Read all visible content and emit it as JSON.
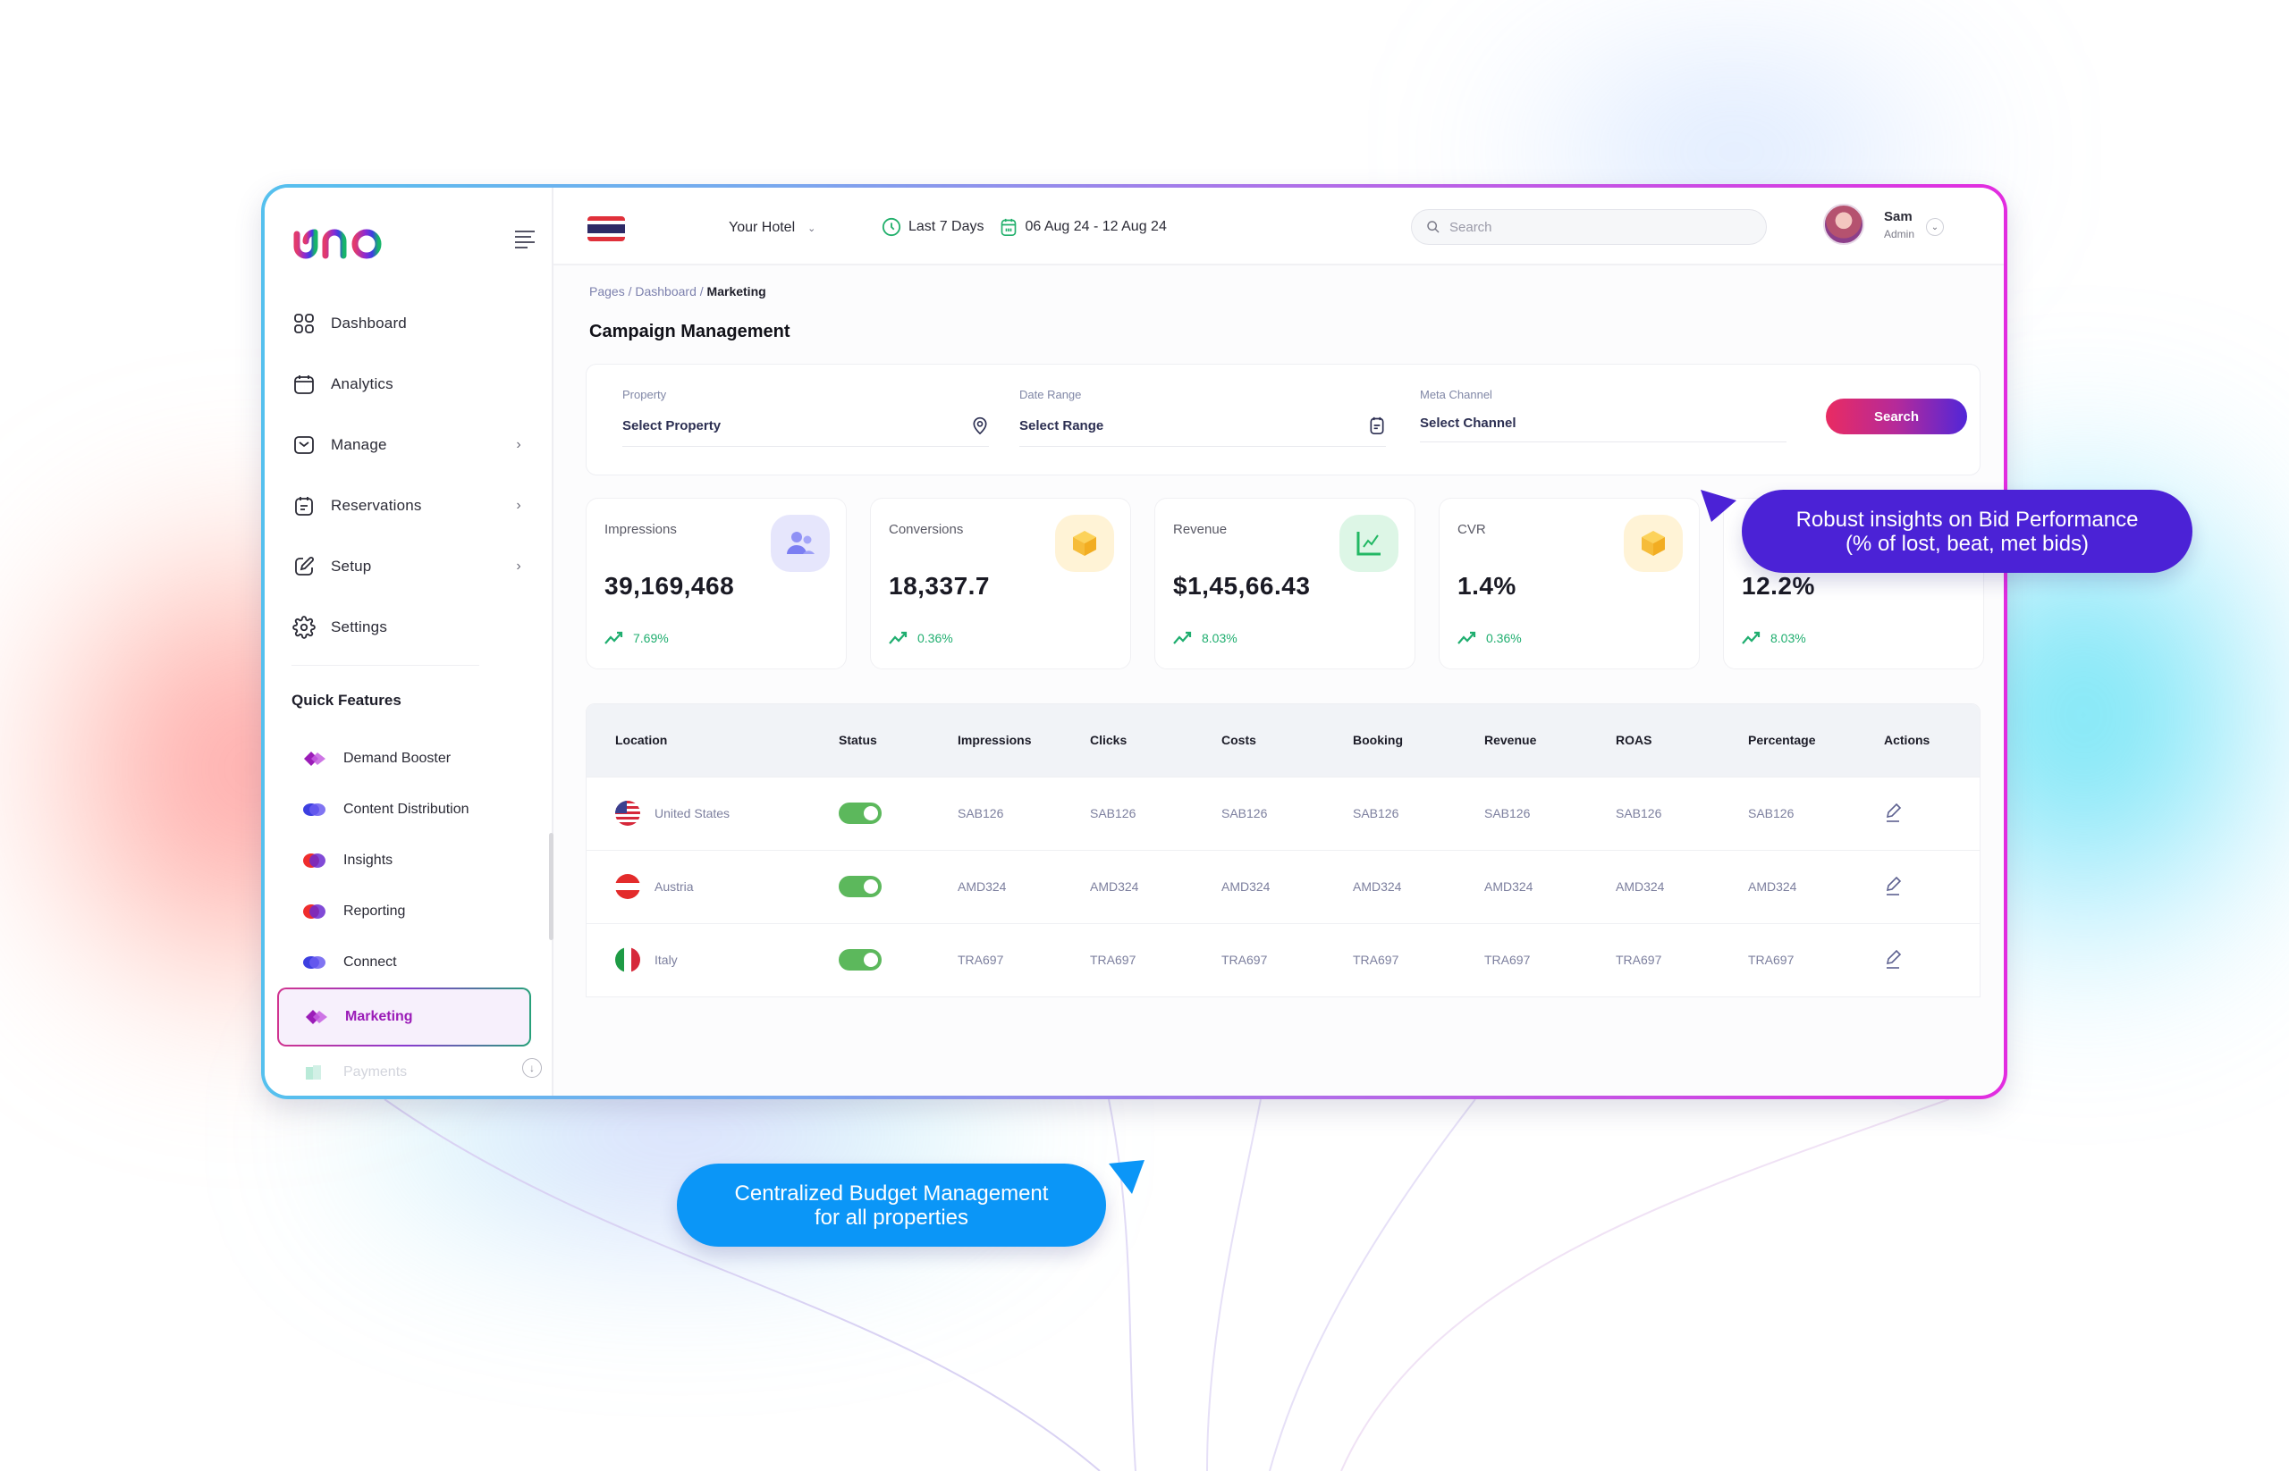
{
  "sidebar": {
    "logo_text": "uno",
    "nav": [
      {
        "label": "Dashboard",
        "icon": "grid-icon",
        "has_submenu": false
      },
      {
        "label": "Analytics",
        "icon": "calendar-icon",
        "has_submenu": false
      },
      {
        "label": "Manage",
        "icon": "inbox-icon",
        "has_submenu": true
      },
      {
        "label": "Reservations",
        "icon": "calendar-note-icon",
        "has_submenu": true
      },
      {
        "label": "Setup",
        "icon": "edit-icon",
        "has_submenu": true
      },
      {
        "label": "Settings",
        "icon": "gear-icon",
        "has_submenu": false
      }
    ],
    "quick_features_title": "Quick Features",
    "quick_features": [
      {
        "label": "Demand Booster",
        "icon": "demand-booster-icon"
      },
      {
        "label": "Content Distribution",
        "icon": "content-distribution-icon"
      },
      {
        "label": "Insights",
        "icon": "insights-icon"
      },
      {
        "label": "Reporting",
        "icon": "reporting-icon"
      },
      {
        "label": "Connect",
        "icon": "connect-icon"
      },
      {
        "label": "Marketing",
        "icon": "marketing-icon",
        "active": true
      },
      {
        "label": "Payments",
        "icon": "payments-icon"
      }
    ],
    "chevron": "›",
    "scroll_down": "↓"
  },
  "header": {
    "hotel_label": "Your Hotel",
    "hotel_chevron": "⌄",
    "range_preset": "Last 7 Days",
    "range_dates": "06 Aug 24 - 12 Aug 24",
    "search_placeholder": "Search",
    "user_name": "Sam",
    "user_role": "Admin",
    "user_chevron": "⌄"
  },
  "breadcrumb": {
    "items": [
      "Pages",
      "Dashboard"
    ],
    "separator": " / ",
    "current": "Marketing"
  },
  "page_title": "Campaign Management",
  "filters": {
    "property": {
      "label": "Property",
      "value": "Select Property"
    },
    "date_range": {
      "label": "Date Range",
      "value": "Select Range"
    },
    "meta_channel": {
      "label": "Meta Channel",
      "value": "Select Channel"
    },
    "search_button": "Search"
  },
  "kpis": [
    {
      "label": "Impressions",
      "value": "39,169,468",
      "trend": "7.69%",
      "icon": "users-icon",
      "icon_bg": "#e6e6fc",
      "icon_color": "#7b7ef2"
    },
    {
      "label": "Conversions",
      "value": "18,337.7",
      "trend": "0.36%",
      "icon": "box-icon",
      "icon_bg": "#fff3d6",
      "icon_color": "#f6bc3a"
    },
    {
      "label": "Revenue",
      "value": "$1,45,66.43",
      "trend": "8.03%",
      "icon": "chart-line-icon",
      "icon_bg": "#ddf6e6",
      "icon_color": "#22b864"
    },
    {
      "label": "CVR",
      "value": "1.4%",
      "trend": "0.36%",
      "icon": "box-icon",
      "icon_bg": "#fff3d6",
      "icon_color": "#f6bc3a"
    },
    {
      "label": "",
      "value": "12.2%",
      "trend": "8.03%",
      "icon": "",
      "icon_bg": "",
      "icon_color": ""
    }
  ],
  "table": {
    "columns": [
      "Location",
      "Status",
      "Impressions",
      "Clicks",
      "Costs",
      "Booking",
      "Revenue",
      "ROAS",
      "Percentage",
      "Actions"
    ],
    "rows": [
      {
        "location": "United States",
        "flag": "us",
        "status_on": true,
        "values": [
          "SAB126",
          "SAB126",
          "SAB126",
          "SAB126",
          "SAB126",
          "SAB126",
          "SAB126"
        ]
      },
      {
        "location": "Austria",
        "flag": "at",
        "status_on": true,
        "values": [
          "AMD324",
          "AMD324",
          "AMD324",
          "AMD324",
          "AMD324",
          "AMD324",
          "AMD324"
        ]
      },
      {
        "location": "Italy",
        "flag": "it",
        "status_on": true,
        "values": [
          "TRA697",
          "TRA697",
          "TRA697",
          "TRA697",
          "TRA697",
          "TRA697",
          "TRA697"
        ]
      }
    ]
  },
  "callouts": {
    "bid_line1": "Robust insights on Bid Performance",
    "bid_line2": "(% of lost, beat, met bids)",
    "budget_line1": "Centralized Budget Management",
    "budget_line2": "for all properties"
  },
  "colors": {
    "accent_purple": "#4b22d6",
    "accent_blue": "#0b96f7",
    "trend_green": "#1fae6f",
    "toggle_green": "#5cb85c",
    "active_text": "#9b1cb8"
  }
}
